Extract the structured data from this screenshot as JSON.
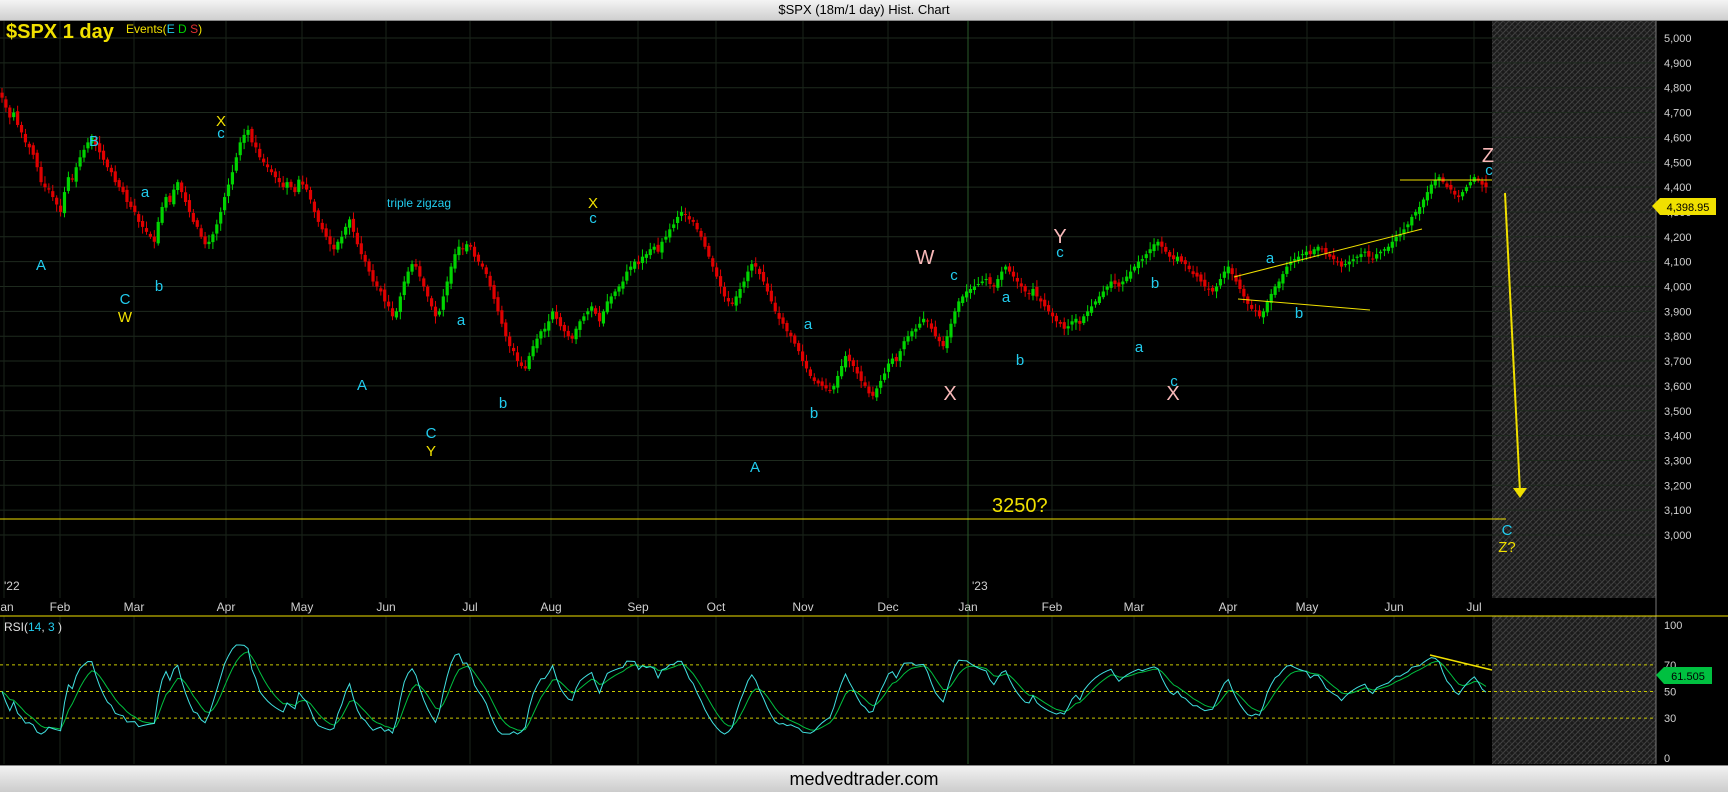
{
  "window_title": "$SPX (18m/1 day) Hist. Chart",
  "footer_text": "medvedtrader.com",
  "header": {
    "symbol_label": "$SPX 1 day",
    "events_label": "Events(",
    "events_e": "E",
    "events_d": "D",
    "events_s": "S",
    "events_close": ")"
  },
  "price_box": "4,398.95",
  "rsi_box": "61.505",
  "colors": {
    "up": "#00d400",
    "down": "#e00000",
    "wave_cyan": "#22ccee",
    "wave_yellow": "#f0e000",
    "wave_pink": "#f8b8b8",
    "rsi_green": "#00c040",
    "rsi_cyan": "#40e0e0",
    "annotation": "#f0e000"
  },
  "chart_data": [
    {
      "type": "candlestick",
      "title": "$SPX 1 day",
      "y_ticks": [
        "5,000",
        "4,900",
        "4,800",
        "4,700",
        "4,600",
        "4,500",
        "4,400",
        "4,300",
        "4,200",
        "4,100",
        "4,000",
        "3,900",
        "3,800",
        "3,700",
        "3,600",
        "3,500",
        "3,400",
        "3,300",
        "3,200",
        "3,100",
        "3,000"
      ],
      "ylim": [
        3000,
        5000
      ],
      "x_ticks": [
        "Jan",
        "Feb",
        "Mar",
        "Apr",
        "May",
        "Jun",
        "Jul",
        "Aug",
        "Sep",
        "Oct",
        "Nov",
        "Dec",
        "Jan",
        "Feb",
        "Mar",
        "Apr",
        "May",
        "Jun",
        "Jul"
      ],
      "year_labels": [
        "'22",
        "'23"
      ],
      "series_closes": [
        4760,
        4720,
        4680,
        4700,
        4650,
        4620,
        4580,
        4560,
        4530,
        4480,
        4420,
        4400,
        4390,
        4360,
        4330,
        4300,
        4380,
        4440,
        4430,
        4480,
        4520,
        4550,
        4580,
        4600,
        4570,
        4540,
        4510,
        4480,
        4460,
        4420,
        4400,
        4380,
        4340,
        4320,
        4300,
        4260,
        4240,
        4220,
        4200,
        4180,
        4260,
        4320,
        4360,
        4340,
        4390,
        4420,
        4380,
        4340,
        4300,
        4260,
        4240,
        4200,
        4170,
        4180,
        4210,
        4250,
        4300,
        4360,
        4410,
        4460,
        4520,
        4580,
        4610,
        4630,
        4580,
        4560,
        4520,
        4500,
        4480,
        4460,
        4440,
        4420,
        4400,
        4420,
        4400,
        4380,
        4430,
        4410,
        4390,
        4350,
        4300,
        4260,
        4230,
        4200,
        4170,
        4150,
        4180,
        4200,
        4240,
        4270,
        4220,
        4170,
        4130,
        4100,
        4060,
        4020,
        4000,
        3980,
        3940,
        3920,
        3880,
        3900,
        3960,
        4020,
        4060,
        4090,
        4080,
        4040,
        4000,
        3960,
        3920,
        3880,
        3900,
        3960,
        4020,
        4080,
        4130,
        4160,
        4150,
        4170,
        4160,
        4120,
        4100,
        4080,
        4050,
        4000,
        3950,
        3900,
        3850,
        3800,
        3760,
        3740,
        3700,
        3680,
        3670,
        3720,
        3760,
        3790,
        3820,
        3830,
        3860,
        3900,
        3870,
        3840,
        3820,
        3800,
        3790,
        3830,
        3860,
        3880,
        3900,
        3920,
        3890,
        3860,
        3900,
        3940,
        3960,
        3980,
        4000,
        4020,
        4060,
        4080,
        4100,
        4090,
        4120,
        4130,
        4150,
        4160,
        4140,
        4180,
        4200,
        4230,
        4250,
        4280,
        4300,
        4290,
        4270,
        4260,
        4230,
        4200,
        4160,
        4120,
        4080,
        4040,
        4000,
        3960,
        3940,
        3930,
        3960,
        3990,
        4020,
        4060,
        4090,
        4080,
        4050,
        4020,
        3980,
        3940,
        3900,
        3870,
        3850,
        3820,
        3800,
        3770,
        3740,
        3700,
        3670,
        3640,
        3620,
        3610,
        3600,
        3590,
        3580,
        3600,
        3640,
        3680,
        3720,
        3700,
        3680,
        3650,
        3620,
        3600,
        3570,
        3560,
        3590,
        3620,
        3650,
        3690,
        3710,
        3700,
        3740,
        3780,
        3800,
        3820,
        3830,
        3850,
        3870,
        3860,
        3830,
        3800,
        3780,
        3760,
        3800,
        3850,
        3900,
        3940,
        3960,
        3980,
        3990,
        4000,
        4010,
        4020,
        4030,
        4010,
        4000,
        4030,
        4060,
        4080,
        4060,
        4040,
        4020,
        4000,
        3980,
        3970,
        3990,
        3960,
        3940,
        3920,
        3900,
        3880,
        3860,
        3850,
        3830,
        3840,
        3860,
        3870,
        3850,
        3880,
        3900,
        3920,
        3940,
        3960,
        3980,
        4000,
        4020,
        4010,
        4000,
        4020,
        4040,
        4060,
        4080,
        4100,
        4110,
        4130,
        4150,
        4170,
        4180,
        4160,
        4140,
        4120,
        4110,
        4120,
        4100,
        4090,
        4070,
        4050,
        4040,
        4020,
        4000,
        3990,
        3980,
        4000,
        4030,
        4060,
        4080,
        4050,
        4020,
        3990,
        3960,
        3930,
        3910,
        3900,
        3880,
        3900,
        3940,
        3970,
        4000,
        4020,
        4050,
        4080,
        4100,
        4110,
        4120,
        4130,
        4140,
        4130,
        4150,
        4160,
        4150,
        4130,
        4120,
        4110,
        4100,
        4080,
        4090,
        4100,
        4110,
        4120,
        4130,
        4140,
        4120,
        4110,
        4130,
        4140,
        4150,
        4160,
        4180,
        4200,
        4210,
        4230,
        4250,
        4280,
        4300,
        4320,
        4350,
        4380,
        4410,
        4430,
        4440,
        4420,
        4400,
        4390,
        4370,
        4360,
        4380,
        4400,
        4420,
        4440,
        4430,
        4410,
        4400
      ]
    },
    {
      "type": "line",
      "title": "RSI( 14, 3 )",
      "rsi_label": "RSI(",
      "rsi_p1": "14",
      "rsi_p2": "3",
      "y_ticks": [
        "100",
        "70",
        "50",
        "30",
        "0"
      ],
      "ylim": [
        0,
        100
      ],
      "levels": [
        70,
        50,
        30
      ]
    }
  ],
  "annotations": {
    "triple_zigzag": "triple zigzag",
    "target": "3250?",
    "labels": [
      {
        "t": "A",
        "c": "cyan"
      },
      {
        "t": "B",
        "c": "cyan"
      },
      {
        "t": "C",
        "c": "cyan"
      },
      {
        "t": "W",
        "c": "yellow"
      },
      {
        "t": "a",
        "c": "cyan"
      },
      {
        "t": "b",
        "c": "cyan"
      },
      {
        "t": "c",
        "c": "cyan"
      },
      {
        "t": "X",
        "c": "yellow"
      },
      {
        "t": "A",
        "c": "cyan"
      },
      {
        "t": "C",
        "c": "cyan"
      },
      {
        "t": "Y",
        "c": "yellow"
      },
      {
        "t": "a",
        "c": "cyan"
      },
      {
        "t": "b",
        "c": "cyan"
      },
      {
        "t": "c",
        "c": "cyan"
      },
      {
        "t": "X",
        "c": "yellow"
      },
      {
        "t": "A",
        "c": "cyan"
      },
      {
        "t": "a",
        "c": "cyan"
      },
      {
        "t": "b",
        "c": "cyan"
      },
      {
        "t": "c",
        "c": "cyan"
      },
      {
        "t": "W",
        "c": "pink"
      },
      {
        "t": "X",
        "c": "pink"
      },
      {
        "t": "a",
        "c": "cyan"
      },
      {
        "t": "b",
        "c": "cyan"
      },
      {
        "t": "c",
        "c": "cyan"
      },
      {
        "t": "Y",
        "c": "pink"
      },
      {
        "t": "a",
        "c": "cyan"
      },
      {
        "t": "b",
        "c": "cyan"
      },
      {
        "t": "c",
        "c": "cyan"
      },
      {
        "t": "X",
        "c": "pink"
      },
      {
        "t": "a",
        "c": "cyan"
      },
      {
        "t": "b",
        "c": "cyan"
      },
      {
        "t": "c",
        "c": "cyan"
      },
      {
        "t": "Z",
        "c": "pink"
      },
      {
        "t": "C",
        "c": "cyan"
      },
      {
        "t": "Z?",
        "c": "yellow"
      }
    ]
  }
}
